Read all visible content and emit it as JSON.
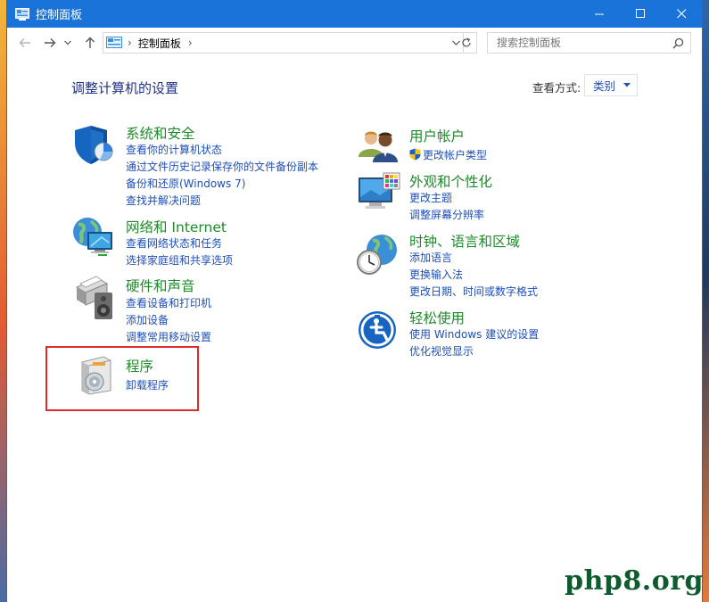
{
  "window": {
    "title": "控制面板"
  },
  "address": {
    "path_item": "控制面板",
    "separator": "›"
  },
  "search": {
    "placeholder": "搜索控制面板"
  },
  "heading": "调整计算机的设置",
  "view": {
    "label": "查看方式:",
    "selected": "类别"
  },
  "categories": {
    "system": {
      "title": "系统和安全",
      "links": [
        "查看你的计算机状态",
        "通过文件历史记录保存你的文件备份副本",
        "备份和还原(Windows 7)",
        "查找并解决问题"
      ]
    },
    "network": {
      "title": "网络和 Internet",
      "links": [
        "查看网络状态和任务",
        "选择家庭组和共享选项"
      ]
    },
    "hardware": {
      "title": "硬件和声音",
      "links": [
        "查看设备和打印机",
        "添加设备",
        "调整常用移动设置"
      ]
    },
    "programs": {
      "title": "程序",
      "links": [
        "卸载程序"
      ]
    },
    "accounts": {
      "title": "用户帐户",
      "links": [
        "更改帐户类型"
      ]
    },
    "appearance": {
      "title": "外观和个性化",
      "links": [
        "更改主题",
        "调整屏幕分辨率"
      ]
    },
    "clock": {
      "title": "时钟、语言和区域",
      "links": [
        "添加语言",
        "更换输入法",
        "更改日期、时间或数字格式"
      ]
    },
    "ease": {
      "title": "轻松使用",
      "links": [
        "使用 Windows 建议的设置",
        "优化视觉显示"
      ]
    }
  },
  "watermark": "php8.org",
  "colors": {
    "titlebar": "#1a73d9",
    "category_title": "#1f8a2a",
    "link": "#1e4fb8",
    "heading": "#1e3287",
    "highlight": "#e02b2b"
  }
}
